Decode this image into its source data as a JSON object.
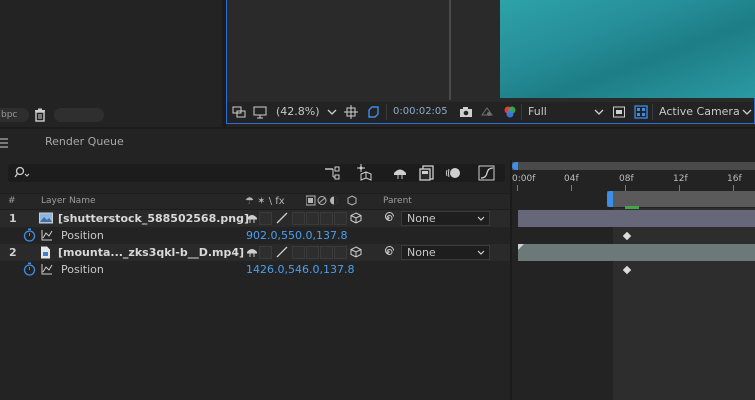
{
  "project": {
    "bpc_label": "bpc"
  },
  "viewer": {
    "zoom": "(42.8%)",
    "timecode": "0:00:02:05",
    "resolution": "Full",
    "camera": "Active Camera"
  },
  "timeline": {
    "tab": "Render Queue",
    "columns": {
      "number": "#",
      "layer_name": "Layer Name",
      "switches": "☂ ✶ \\ fx",
      "parent": "Parent"
    },
    "layers": [
      {
        "index": "1",
        "name": "[shutterstock_588502568.png]",
        "parent": "None",
        "property": "Position",
        "value": "902.0,550.0,137.8"
      },
      {
        "index": "2",
        "name": "[mounta..._zks3qkl-b__D.mp4]",
        "parent": "None",
        "property": "Position",
        "value": "1426.0,546.0,137.8"
      }
    ],
    "ruler": [
      "0:00f",
      "04f",
      "08f",
      "12f",
      "16f"
    ]
  },
  "colors": {
    "accent": "#2d6fd1",
    "value_blue": "#4a9fef",
    "layer1_bar": "#67677a",
    "layer2_bar": "#6b7a78"
  }
}
